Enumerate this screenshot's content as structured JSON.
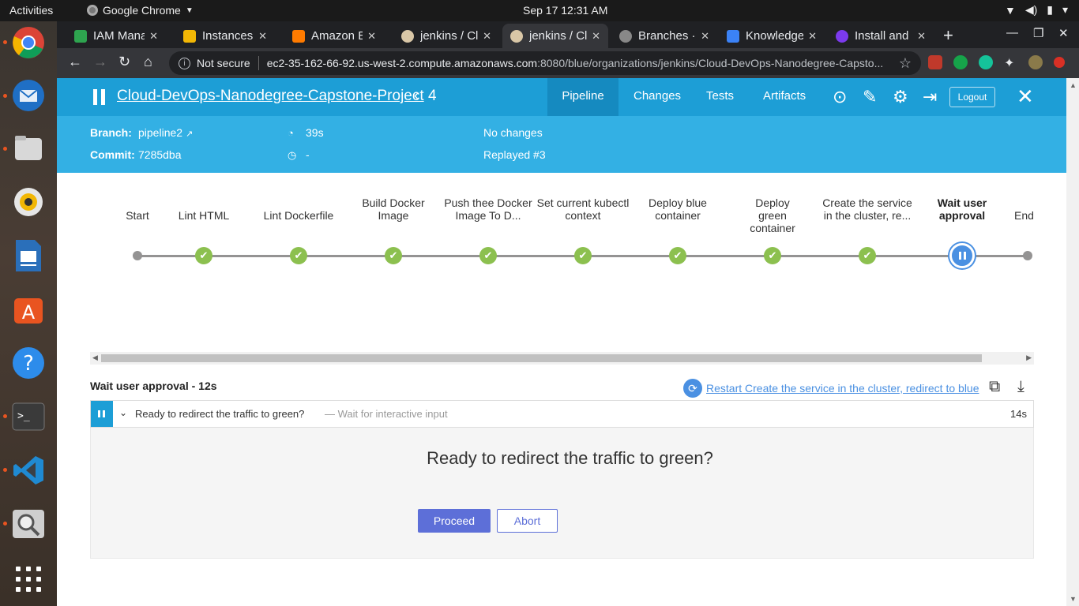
{
  "system": {
    "activities": "Activities",
    "app_name": "Google Chrome",
    "clock": "Sep 17  12:31 AM"
  },
  "dock": {
    "apps": [
      "chrome-icon",
      "thunderbird-icon",
      "files-icon",
      "rhythmbox-icon",
      "libreoffice-writer-icon",
      "software-center-icon",
      "help-icon",
      "terminal-icon",
      "vscode-icon",
      "image-viewer-icon",
      "show-apps-icon"
    ]
  },
  "browser": {
    "tabs": [
      {
        "title": "IAM Manag",
        "fav_color": "#2ea44f"
      },
      {
        "title": "Instances |",
        "fav_color": "#f2b705"
      },
      {
        "title": "Amazon El",
        "fav_color": "#ff7b00"
      },
      {
        "title": "jenkins / Cl",
        "fav_color": "#d9c7a7"
      },
      {
        "title": "jenkins / Cl",
        "fav_color": "#d9c7a7"
      },
      {
        "title": "Branches ·",
        "fav_color": "#888888"
      },
      {
        "title": "Knowledge",
        "fav_color": "#3b82f6"
      },
      {
        "title": "Install and",
        "fav_color": "#7c3aed"
      }
    ],
    "url_security": "Not secure",
    "url_host": "ec2-35-162-66-92.us-west-2.compute.amazonaws.com",
    "url_rest": ":8080/blue/organizations/jenkins/Cloud-DevOps-Nanodegree-Capsto..."
  },
  "jenkins": {
    "project": "Cloud-DevOps-Nanodegree-Capstone-Project",
    "run_number": "4",
    "tabs": [
      "Pipeline",
      "Changes",
      "Tests",
      "Artifacts"
    ],
    "logout_label": "Logout",
    "branch_label": "Branch:",
    "branch_value": "pipeline2",
    "commit_label": "Commit:",
    "commit_value": "7285dba",
    "duration": "39s",
    "ended": "-",
    "changes": "No changes",
    "replayed": "Replayed #3"
  },
  "pipeline": {
    "stages": [
      {
        "label": "Start",
        "status": "start"
      },
      {
        "label": "Lint HTML",
        "status": "success"
      },
      {
        "label": "Lint Dockerfile",
        "status": "success"
      },
      {
        "label": "Build Docker Image",
        "status": "success"
      },
      {
        "label": "Push thee Docker Image To D...",
        "status": "success"
      },
      {
        "label": "Set current kubectl context",
        "status": "success"
      },
      {
        "label": "Deploy blue container",
        "status": "success"
      },
      {
        "label": "Deploy green container",
        "status": "success"
      },
      {
        "label": "Create the service in the cluster, re...",
        "status": "success"
      },
      {
        "label": "Wait user approval",
        "status": "paused"
      },
      {
        "label": "End",
        "status": "end"
      }
    ]
  },
  "step": {
    "title": "Wait user approval - 12s",
    "restart_label": "Restart Create the service in the cluster, redirect to blue",
    "row_text": "Ready to redirect the traffic to green?",
    "row_sub": "— Wait for interactive input",
    "row_duration": "14s",
    "question": "Ready to redirect the traffic to green?",
    "proceed_label": "Proceed",
    "abort_label": "Abort"
  }
}
